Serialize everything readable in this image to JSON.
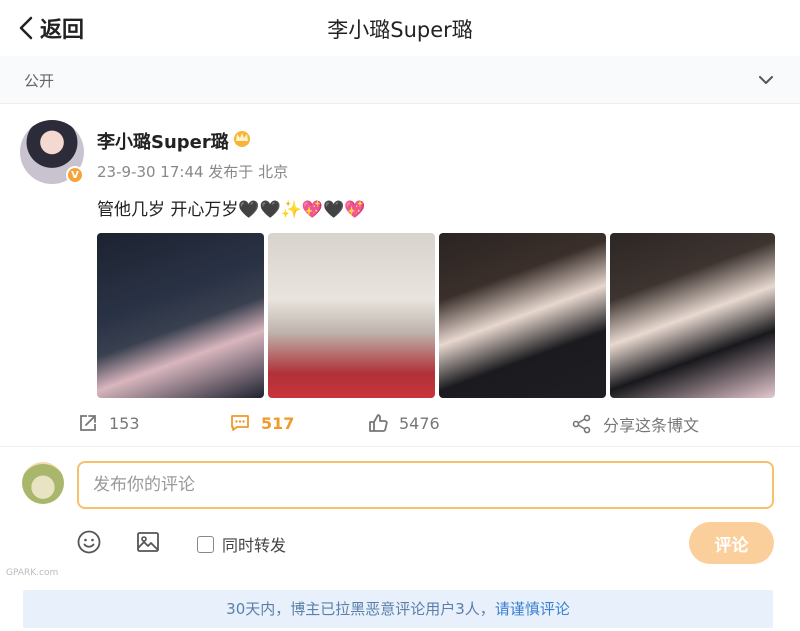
{
  "header": {
    "back_label": "返回",
    "title": "李小璐Super璐"
  },
  "visibility": {
    "label": "公开"
  },
  "post": {
    "username": "李小璐Super璐",
    "meta": "23-9-30 17:44 发布于 北京",
    "text": "管他几岁 开心万岁🖤🖤✨💖🖤💖",
    "verified_badge": "V",
    "images": [
      "photo-1",
      "photo-2",
      "photo-3",
      "photo-4"
    ]
  },
  "actions": {
    "repost_count": "153",
    "comment_count": "517",
    "like_count": "5476",
    "share_label": "分享这条博文"
  },
  "comment": {
    "placeholder": "发布你的评论",
    "repost_label": "同时转发",
    "submit_label": "评论"
  },
  "watermark": "GPARK.com",
  "notice": {
    "text": "30天内，博主已拉黑恶意评论用户3人，",
    "link": "请谨慎评论"
  },
  "colors": {
    "accent": "#f19a2c",
    "notice_bg": "#e8f1fb",
    "link": "#3b7fd0"
  }
}
